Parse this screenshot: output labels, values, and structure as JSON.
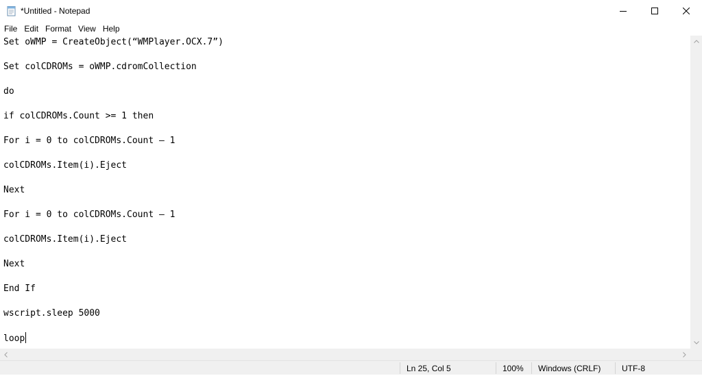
{
  "window": {
    "title": "*Untitled - Notepad",
    "icon": "notepad-icon"
  },
  "menu": {
    "items": [
      "File",
      "Edit",
      "Format",
      "View",
      "Help"
    ]
  },
  "editor": {
    "lines": [
      "Set oWMP = CreateObject(“WMPlayer.OCX.7”)",
      "",
      "Set colCDROMs = oWMP.cdromCollection",
      "",
      "do",
      "",
      "if colCDROMs.Count >= 1 then",
      "",
      "For i = 0 to colCDROMs.Count – 1",
      "",
      "colCDROMs.Item(i).Eject",
      "",
      "Next",
      "",
      "For i = 0 to colCDROMs.Count – 1",
      "",
      "colCDROMs.Item(i).Eject",
      "",
      "Next",
      "",
      "End If",
      "",
      "wscript.sleep 5000",
      "",
      "loop"
    ]
  },
  "status": {
    "position": "Ln 25, Col 5",
    "zoom": "100%",
    "line_ending": "Windows (CRLF)",
    "encoding": "UTF-8"
  }
}
